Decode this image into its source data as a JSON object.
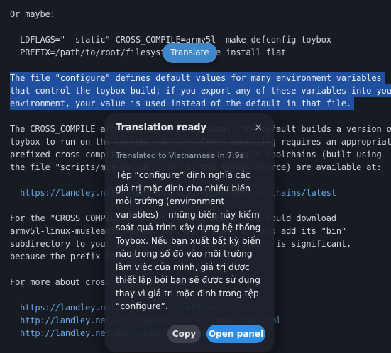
{
  "document": {
    "lines": [
      {
        "text": "Or maybe:"
      },
      {
        "text": "  LDFLAGS=\"--static\" CROSS_COMPILE=armv5l- make defconfig toybox"
      },
      {
        "text": "  PREFIX=/path/to/root/filesystem/bin make install_flat"
      },
      {
        "text": "The file \"configure\" defines default values for many environment variables",
        "selected": true
      },
      {
        "text": "that control the toybox build; if you export any of these variables into your",
        "selected": true
      },
      {
        "text": "environment, your value is used instead of the default in that file.",
        "selected": true
      },
      {
        "text": "The CROSS_COMPILE argument above is optional, the default builds a version of"
      },
      {
        "text": "toybox to run on the current machine. Cross compiling requires an appropriately"
      },
      {
        "text": "prefixed cross compiler toolchain, several example toolchains (built using"
      },
      {
        "text": "the file \"scripts/mcm-buildall.sh\" in the toybox source) are available at:"
      },
      {
        "text": "  https://landley.net/toybox/downloads/binaries/toolchains/latest",
        "link": true
      },
      {
        "text": "For the \"CROSS_COMPILE=armv5l-\" example above, one could download"
      },
      {
        "text": "armv5l-linux-musleabihf-cross.tar.xz, extract it, and add its \"bin\""
      },
      {
        "text": "subdirectory to your $PATH. (And yes, the trailing - is significant,"
      },
      {
        "text": "because the prefix includes a dash.)"
      },
      {
        "text": "For more about cross compiling, see:"
      },
      {
        "text": "  https://landley.net/toybox/faq.html#cross",
        "link": true
      },
      {
        "text": "  http://landley.net/writing/docs/cross-compiling.html",
        "link": true
      },
      {
        "text": "  http://landley.net/aboriginal/architectures.html",
        "link": true
      }
    ]
  },
  "translate_button": {
    "label": "Translate"
  },
  "popup": {
    "title": "Translation ready",
    "close_glyph": "×",
    "meta": "Translated to Vietnamese in 7.9s",
    "translated_text": "Tệp “configure” định nghĩa các giá trị mặc định cho nhiều biến môi trường (environment variables) – những biến này kiểm soát quá trình xây dựng hệ thống Toybox. Nếu bạn xuất bất kỳ biến nào trong số đó vào môi trường làm việc của mình, giá trị được thiết lập bởi bạn sẽ được sử dụng thay vì giá trị mặc định trong tệp “configure”.",
    "copy_label": "Copy",
    "open_label": "Open panel"
  },
  "colors": {
    "background": "#171b22",
    "selection": "#1f4f9e",
    "link": "#6aa7e8",
    "primary_button": "#2f8de4"
  }
}
